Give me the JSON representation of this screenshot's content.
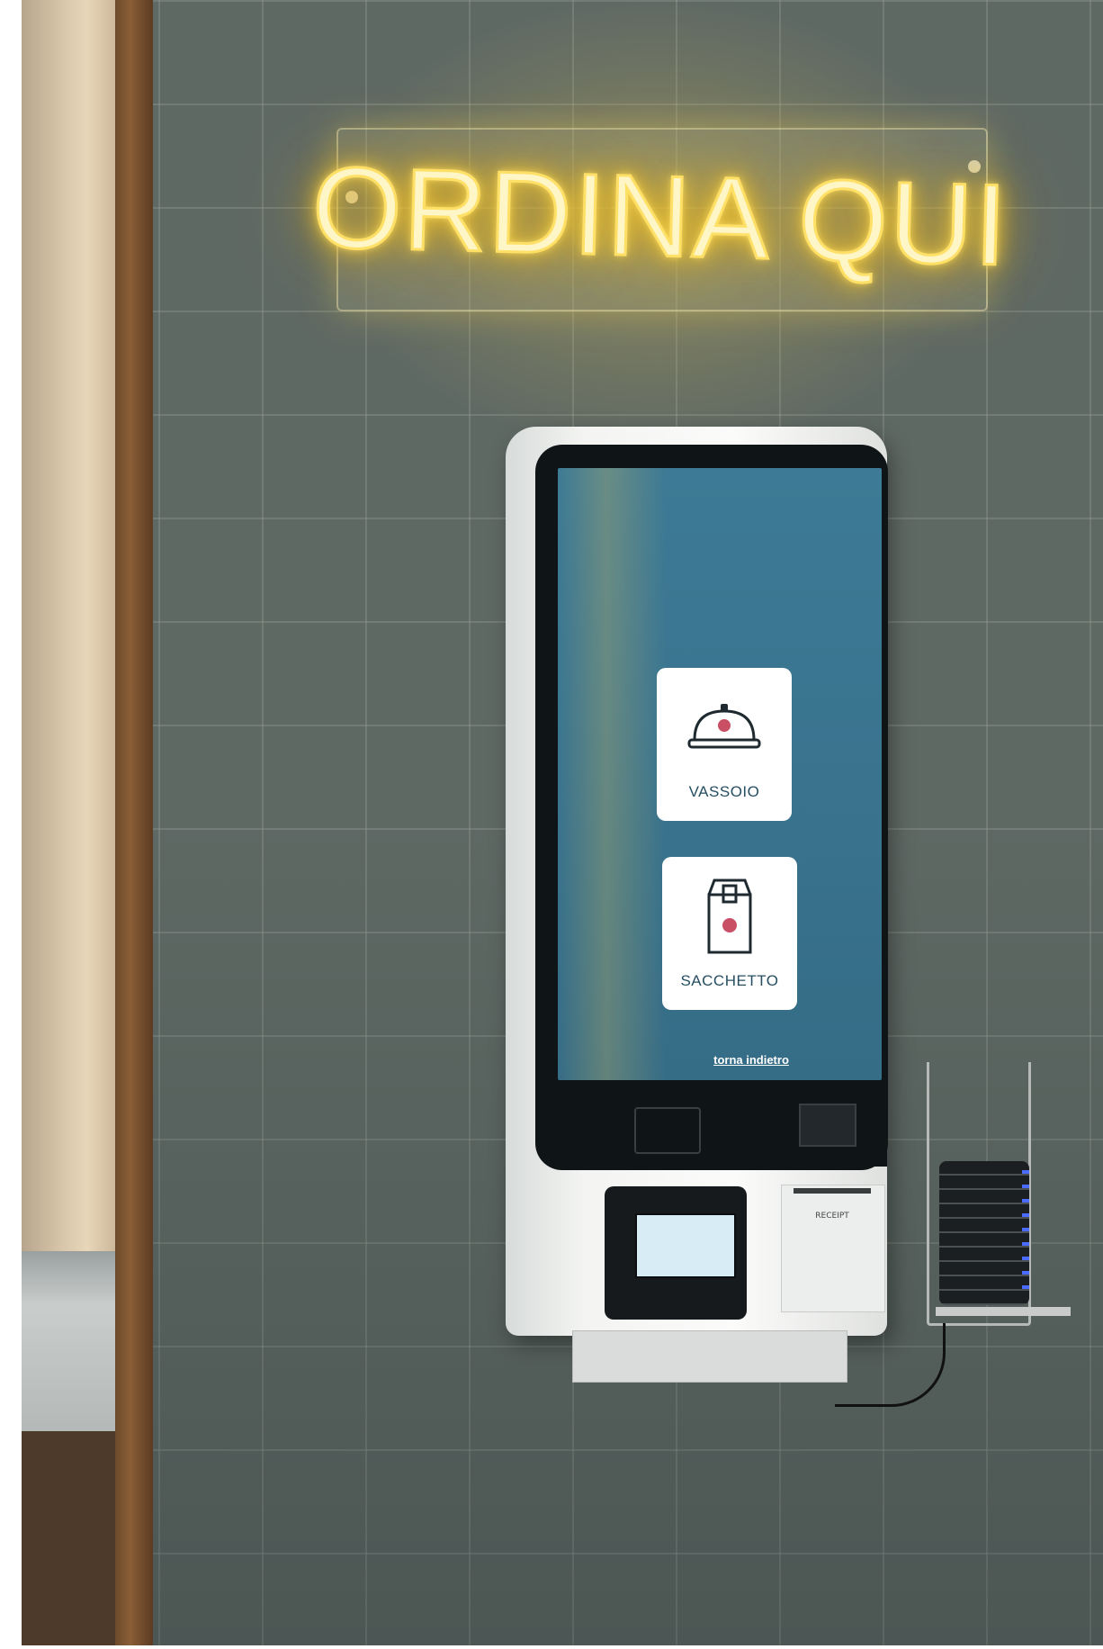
{
  "sign": {
    "text": "ORDINA QUI"
  },
  "kiosk": {
    "options": [
      {
        "label": "VASSOIO",
        "icon": "cloche-icon"
      },
      {
        "label": "SACCHETTO",
        "icon": "bag-icon"
      }
    ],
    "back_link": "torna indietro",
    "printer_label": "RECEIPT"
  },
  "colors": {
    "neon": "#ffe066",
    "screen": "#3a7590",
    "card": "#ffffff",
    "card_text": "#264f63",
    "accent_logo": "#c0304a"
  }
}
